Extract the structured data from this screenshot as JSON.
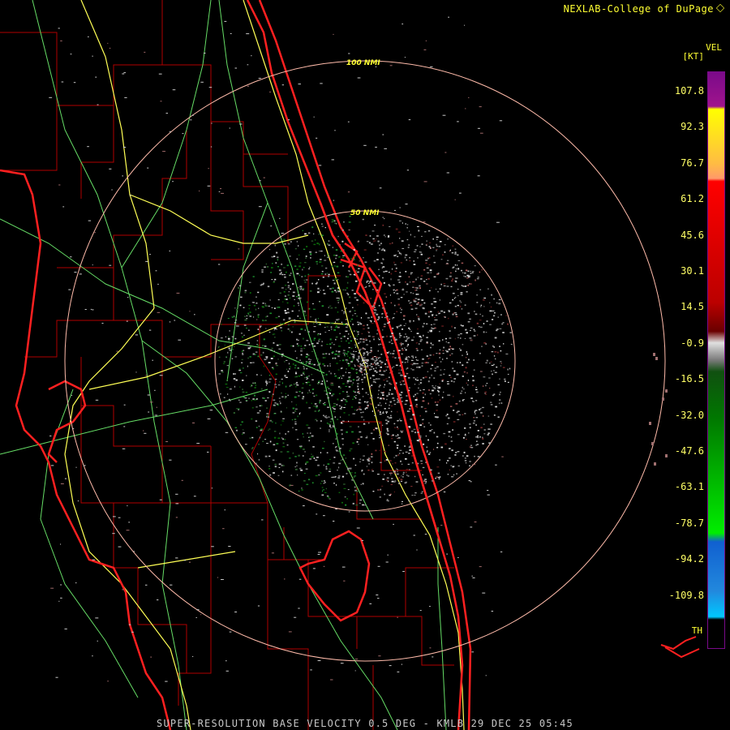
{
  "header": {
    "credit": "NEXLAB-College of DuPage",
    "product_code": "VEL",
    "units": "[KT]"
  },
  "footer": {
    "title": "SUPER-RESOLUTION BASE VELOCITY 0.5 DEG - KMLB 29 DEC 25 05:45"
  },
  "range_rings": [
    {
      "label": "50 NMI"
    },
    {
      "label": "100 NMI"
    }
  ],
  "legend": {
    "values": [
      "107.8",
      "92.3",
      "76.7",
      "61.2",
      "45.6",
      "30.1",
      "14.5",
      "-0.9",
      "-16.5",
      "-32.0",
      "-47.6",
      "-63.1",
      "-78.7",
      "-94.2",
      "-109.8"
    ],
    "range_folded_label": "TH",
    "colors": {
      "purple": "#7a0a8a",
      "yellow": "#ffff00",
      "orange": "#ff9a6a",
      "red": "#ff0000",
      "dark_red": "#6a0000",
      "gray": "#9a9a9a",
      "dark_green": "#105010",
      "green": "#00ee00",
      "blue": "#1060d0",
      "cyan": "#00c8ff",
      "range_folded": "#400040"
    }
  },
  "map_colors": {
    "county_lines": "#b00000",
    "coastline": "#ff2020",
    "highways": "#ffff55",
    "roads": "#66dd66",
    "rings": "#ffbbaa"
  }
}
